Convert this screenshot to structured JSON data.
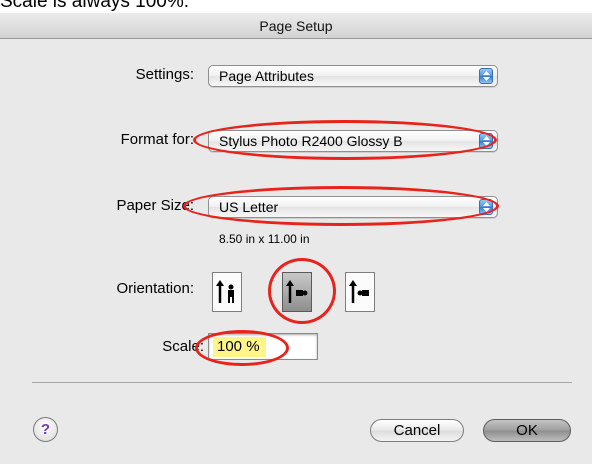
{
  "caption": "Scale is always 100%.",
  "window": {
    "title": "Page Setup"
  },
  "settings": {
    "label": "Settings:",
    "value": "Page Attributes"
  },
  "format_for": {
    "label": "Format for:",
    "value": "Stylus Photo R2400 Glossy B"
  },
  "paper_size": {
    "label": "Paper Size:",
    "value": "US Letter",
    "dimensions": "8.50 in x 11.00 in"
  },
  "orientation": {
    "label": "Orientation:",
    "options": [
      "portrait",
      "landscape-left",
      "landscape-right"
    ],
    "selected": "landscape-left"
  },
  "scale": {
    "label": "Scale:",
    "value": "100 %"
  },
  "buttons": {
    "help": "?",
    "cancel": "Cancel",
    "ok": "OK"
  },
  "colors": {
    "annotation": "#e8231b",
    "scale_highlight": "#fff58a",
    "popup_arrow": "#2f7bd3"
  }
}
